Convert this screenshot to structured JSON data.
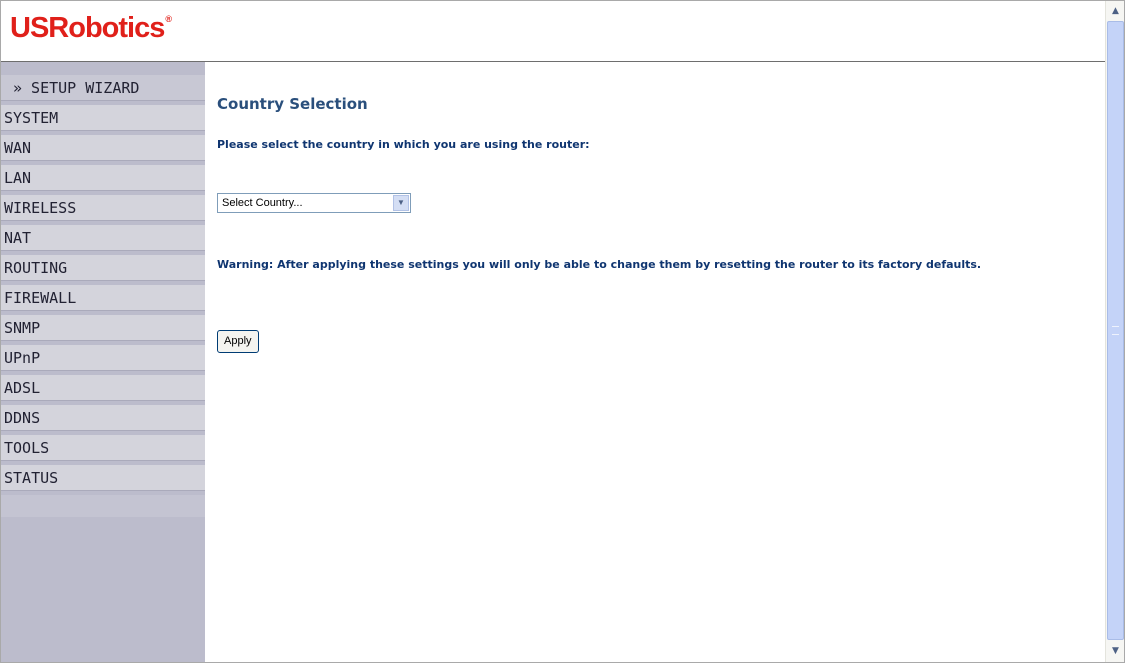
{
  "header": {
    "logo_text": "USRobotics",
    "logo_mark": "®",
    "brand_color": "#e0201a"
  },
  "sidebar": {
    "items": [
      {
        "label": "» SETUP WIZARD",
        "selected": true
      },
      {
        "label": "SYSTEM"
      },
      {
        "label": "WAN"
      },
      {
        "label": "LAN"
      },
      {
        "label": "WIRELESS"
      },
      {
        "label": "NAT"
      },
      {
        "label": "ROUTING"
      },
      {
        "label": "FIREWALL"
      },
      {
        "label": "SNMP"
      },
      {
        "label": "UPnP"
      },
      {
        "label": "ADSL"
      },
      {
        "label": "DDNS"
      },
      {
        "label": "TOOLS"
      },
      {
        "label": "STATUS"
      }
    ]
  },
  "main": {
    "title": "Country Selection",
    "prompt": "Please select the country in which you are using the router:",
    "country_select": {
      "value": "Select Country...",
      "icon": "chevron-down-icon"
    },
    "warning": "Warning: After applying these settings you will only be able to change them by resetting the router to its factory defaults.",
    "apply_label": "Apply"
  },
  "scrollbar": {
    "up_icon": "chevron-up-icon",
    "down_icon": "chevron-down-icon"
  },
  "colors": {
    "title": "#2a4f7c",
    "text": "#0f3570",
    "sidebar_bg": "#bcbccc",
    "nav_item_bg": "#d4d4dc"
  }
}
